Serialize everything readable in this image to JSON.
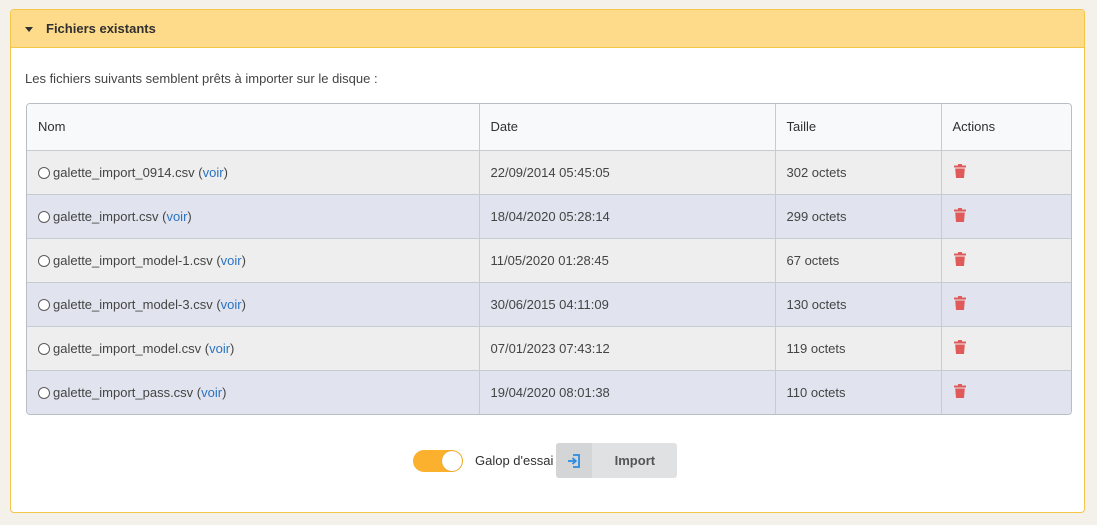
{
  "panel": {
    "title": "Fichiers existants",
    "header_color": "#fedb8b",
    "border_color": "#f3c64a"
  },
  "intro_text": "Les fichiers suivants semblent prêts à importer sur le disque :",
  "table": {
    "columns": [
      "Nom",
      "Date",
      "Taille",
      "Actions"
    ],
    "link_label": "voir",
    "rows": [
      {
        "name": "galette_import_0914.csv",
        "date": "22/09/2014 05:45:05",
        "size": "302 octets"
      },
      {
        "name": "galette_import.csv",
        "date": "18/04/2020 05:28:14",
        "size": "299 octets"
      },
      {
        "name": "galette_import_model-1.csv",
        "date": "11/05/2020 01:28:45",
        "size": "67 octets"
      },
      {
        "name": "galette_import_model-3.csv",
        "date": "30/06/2015 04:11:09",
        "size": "130 octets"
      },
      {
        "name": "galette_import_model.csv",
        "date": "07/01/2023 07:43:12",
        "size": "119 octets"
      },
      {
        "name": "galette_import_pass.csv",
        "date": "19/04/2020 08:01:38",
        "size": "110 octets"
      }
    ],
    "delete_icon": "trash-icon",
    "delete_color": "#e05a5a"
  },
  "dry_run": {
    "label": "Galop d'essai",
    "enabled": true,
    "color": "#fbb12d"
  },
  "import_button": {
    "label": "Import",
    "icon": "import-icon",
    "icon_color": "#2a8be0"
  }
}
